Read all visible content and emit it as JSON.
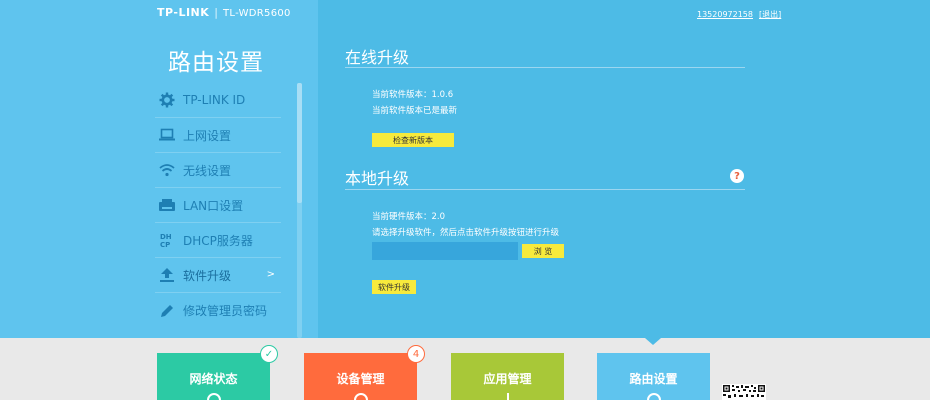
{
  "header": {
    "brand": "TP-LINK",
    "separator": "|",
    "model": "TL-WDR5600",
    "account": "13520972158",
    "logout": "[退出]"
  },
  "sidebar": {
    "title": "路由设置",
    "items": [
      {
        "label": "TP-LINK ID",
        "icon": "gear-icon"
      },
      {
        "label": "上网设置",
        "icon": "laptop-icon"
      },
      {
        "label": "无线设置",
        "icon": "wifi-icon"
      },
      {
        "label": "LAN口设置",
        "icon": "router-icon"
      },
      {
        "label": "DHCP服务器",
        "icon": "dhcp-icon"
      },
      {
        "label": "软件升级",
        "icon": "upload-icon",
        "arrow": ">"
      },
      {
        "label": "修改管理员密码",
        "icon": "pencil-icon"
      }
    ]
  },
  "online_upgrade": {
    "title": "在线升级",
    "current_version": "当前软件版本：1.0.6",
    "status": "当前软件版本已是最新",
    "check_button": "检查新版本"
  },
  "local_upgrade": {
    "title": "本地升级",
    "help": "?",
    "hardware_version": "当前硬件版本：2.0",
    "instruction": "请选择升级软件，然后点击软件升级按钮进行升级",
    "browse_button": "浏 览",
    "upgrade_button": "软件升级"
  },
  "tiles": [
    {
      "label": "网络状态",
      "color": "#2ccaa4",
      "badge": "✓"
    },
    {
      "label": "设备管理",
      "color": "#ff6b3d",
      "badge": "4"
    },
    {
      "label": "应用管理",
      "color": "#a8c838"
    },
    {
      "label": "路由设置",
      "color": "#5fc4ee"
    }
  ],
  "colors": {
    "accent": "#4dbbe6",
    "sidebar": "#5fc4ee",
    "button": "#f7ea3c",
    "menu_text": "#1e7fb3"
  }
}
